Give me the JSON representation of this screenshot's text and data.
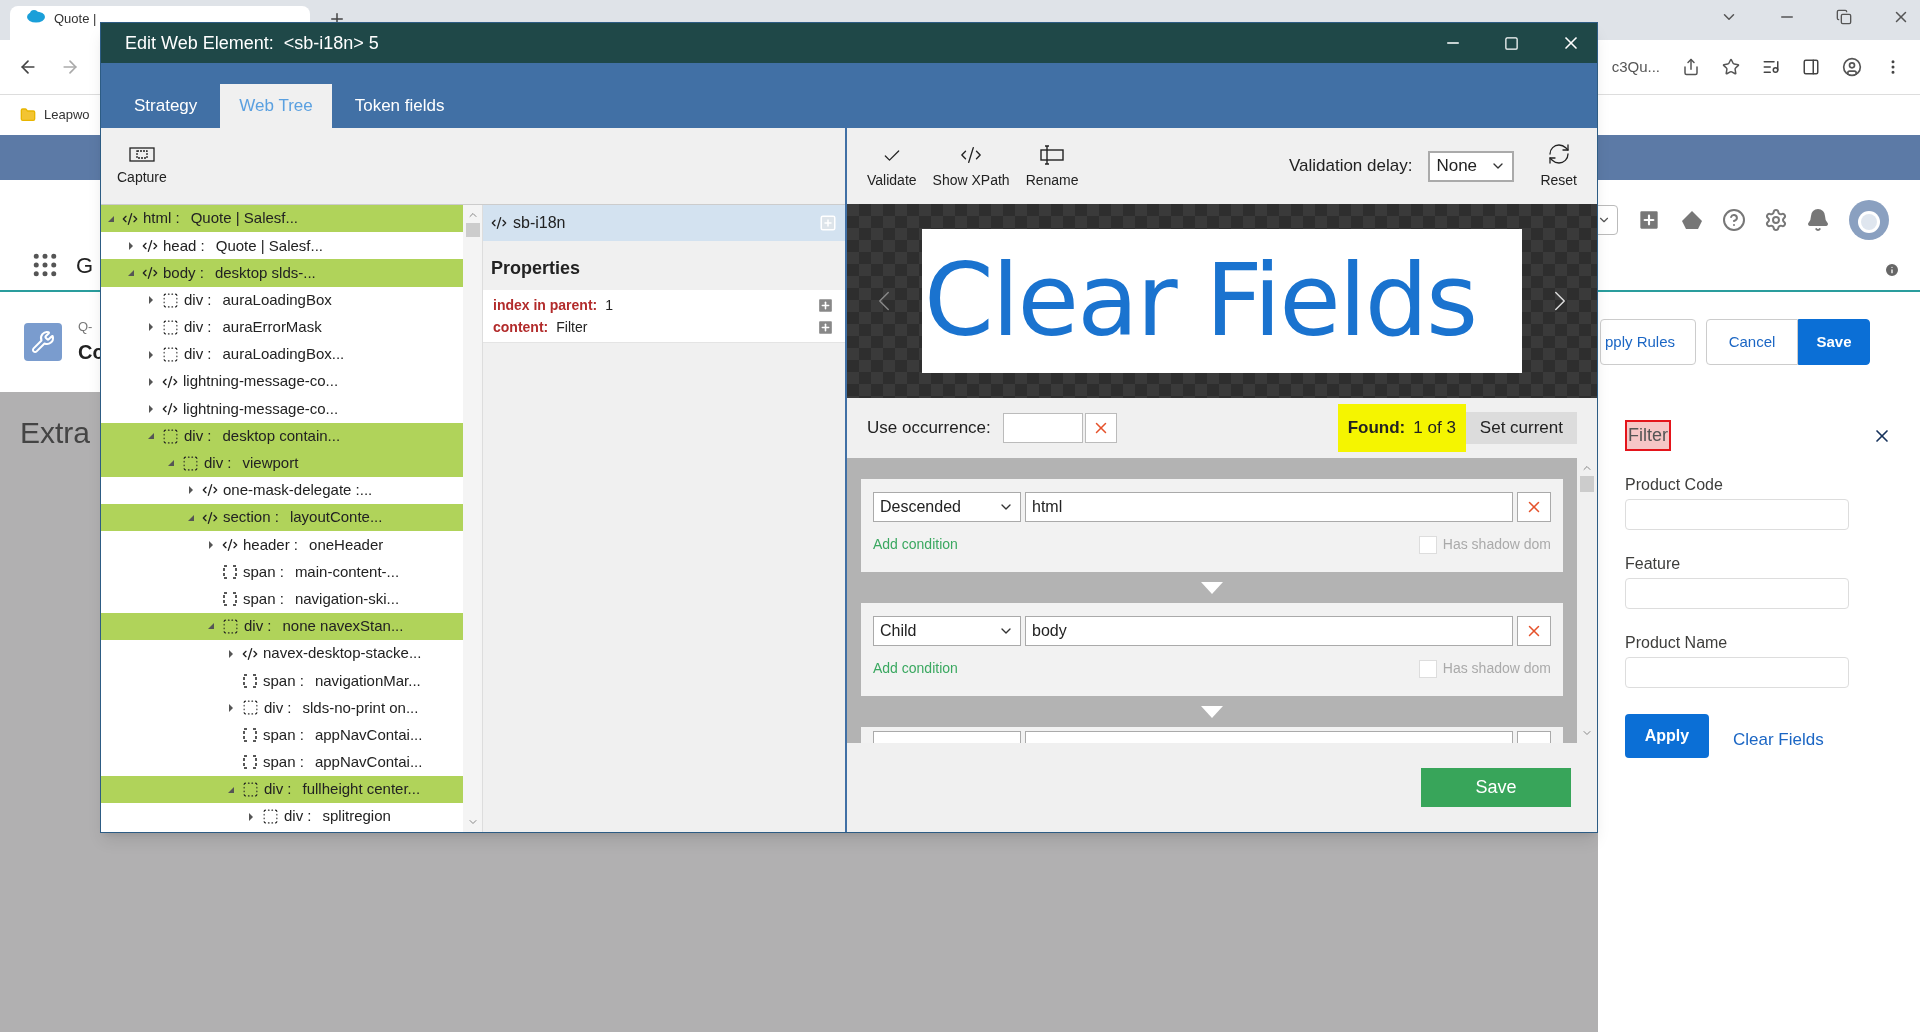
{
  "browser": {
    "tab_title": "Quote |",
    "address_fragment": "c3Qu...",
    "bookmark": "Leapwo"
  },
  "salesforce": {
    "app_letter": "G",
    "record_type": "Q-",
    "record_title": "Co",
    "section_title": "Extra",
    "header_buttons": [
      {
        "label": "pply Rules",
        "primary": false
      },
      {
        "label": "Cancel",
        "primary": false
      },
      {
        "label": "Save",
        "primary": true
      }
    ],
    "filter": {
      "title": "Filter",
      "highlighted": true,
      "fields": [
        {
          "label": "Product Code"
        },
        {
          "label": "Feature"
        },
        {
          "label": "Product Name"
        }
      ],
      "apply": "Apply",
      "clear": "Clear Fields"
    }
  },
  "dialog": {
    "title": "Edit Web Element:  <sb-i18n> 5",
    "tabs": [
      {
        "label": "Strategy",
        "selected": false
      },
      {
        "label": "Web Tree",
        "selected": true
      },
      {
        "label": "Token fields",
        "selected": false
      }
    ],
    "capture": "Capture",
    "tree": [
      {
        "kind": "tag",
        "label": "html :",
        "value": "Quote | Salesf...",
        "highlighted": true,
        "expandable": true,
        "expanded": true,
        "children": [
          {
            "kind": "tag",
            "label": "head :",
            "value": "Quote | Salesf...",
            "highlighted": false,
            "expandable": true,
            "expanded": false
          },
          {
            "kind": "tag",
            "label": "body :",
            "value": "desktop slds-...",
            "highlighted": true,
            "expandable": true,
            "expanded": true,
            "children": [
              {
                "kind": "div",
                "label": "div :",
                "value": "auraLoadingBox",
                "highlighted": false,
                "expandable": true,
                "expanded": false
              },
              {
                "kind": "div",
                "label": "div :",
                "value": "auraErrorMask",
                "highlighted": false,
                "expandable": true,
                "expanded": false
              },
              {
                "kind": "div",
                "label": "div :",
                "value": "auraLoadingBox...",
                "highlighted": false,
                "expandable": true,
                "expanded": false
              },
              {
                "kind": "tag",
                "label": "lightning-message-co...",
                "highlighted": false,
                "expandable": true,
                "expanded": false
              },
              {
                "kind": "tag",
                "label": "lightning-message-co...",
                "highlighted": false,
                "expandable": true,
                "expanded": false
              },
              {
                "kind": "div",
                "label": "div :",
                "value": "desktop contain...",
                "highlighted": true,
                "expandable": true,
                "expanded": true,
                "children": [
                  {
                    "kind": "div",
                    "label": "div :",
                    "value": "viewport",
                    "highlighted": true,
                    "expandable": true,
                    "expanded": true,
                    "children": [
                      {
                        "kind": "tag",
                        "label": "one-mask-delegate :...",
                        "highlighted": false,
                        "expandable": true,
                        "expanded": false
                      },
                      {
                        "kind": "tag",
                        "label": "section :",
                        "value": "layoutConte...",
                        "highlighted": true,
                        "expandable": true,
                        "expanded": true,
                        "children": [
                          {
                            "kind": "tag",
                            "label": "header :",
                            "value": "oneHeader",
                            "highlighted": false,
                            "expandable": true,
                            "expanded": false
                          },
                          {
                            "kind": "span",
                            "label": "span :",
                            "value": "main-content-...",
                            "highlighted": false,
                            "expandable": false
                          },
                          {
                            "kind": "span",
                            "label": "span :",
                            "value": "navigation-ski...",
                            "highlighted": false,
                            "expandable": false
                          },
                          {
                            "kind": "div",
                            "label": "div :",
                            "value": "none navexStan...",
                            "highlighted": true,
                            "expandable": true,
                            "expanded": true,
                            "children": [
                              {
                                "kind": "tag",
                                "label": "navex-desktop-stacke...",
                                "highlighted": false,
                                "expandable": true,
                                "expanded": false
                              },
                              {
                                "kind": "span",
                                "label": "span :",
                                "value": "navigationMar...",
                                "highlighted": false,
                                "expandable": false
                              },
                              {
                                "kind": "div",
                                "label": "div :",
                                "value": "slds-no-print on...",
                                "highlighted": false,
                                "expandable": true,
                                "expanded": false
                              },
                              {
                                "kind": "span",
                                "label": "span :",
                                "value": "appNavContai...",
                                "highlighted": false,
                                "expandable": false
                              },
                              {
                                "kind": "span",
                                "label": "span :",
                                "value": "appNavContai...",
                                "highlighted": false,
                                "expandable": false
                              },
                              {
                                "kind": "div",
                                "label": "div :",
                                "value": "fullheight center...",
                                "highlighted": true,
                                "expandable": true,
                                "expanded": true,
                                "children": [
                                  {
                                    "kind": "div",
                                    "label": "div :",
                                    "value": "splitregion",
                                    "highlighted": false,
                                    "expandable": true,
                                    "expanded": false
                                  }
                                ]
                              }
                            ]
                          }
                        ]
                      }
                    ]
                  }
                ]
              }
            ]
          }
        ]
      }
    ],
    "element": {
      "tag": "sb-i18n"
    },
    "properties": {
      "title": "Properties",
      "items": [
        {
          "name": "index in parent:",
          "value": "1"
        },
        {
          "name": "content:",
          "value": "Filter"
        }
      ]
    },
    "toolbar": [
      {
        "label": "Validate",
        "kind": "check"
      },
      {
        "label": "Show XPath",
        "kind": "code"
      },
      {
        "label": "Rename",
        "kind": "rename"
      }
    ],
    "validation_delay": {
      "label": "Validation delay:",
      "value": "None"
    },
    "reset": "Reset",
    "preview_text": "Clear Fields",
    "occurrence": {
      "label": "Use occurrence:"
    },
    "found": {
      "label": "Found:",
      "value": "1 of 3",
      "highlighted": true
    },
    "set_current": "Set current",
    "steps": [
      {
        "kind": "step",
        "axis": "Descended",
        "value": "html",
        "add_condition": "Add condition",
        "shadow_label": "Has shadow dom",
        "shadow_dom": false
      },
      {
        "kind": "step",
        "axis": "Child",
        "value": "body",
        "add_condition": "Add condition",
        "shadow_label": "Has shadow dom",
        "shadow_dom": false
      },
      {
        "kind": "clipped"
      }
    ],
    "save": "Save"
  }
}
